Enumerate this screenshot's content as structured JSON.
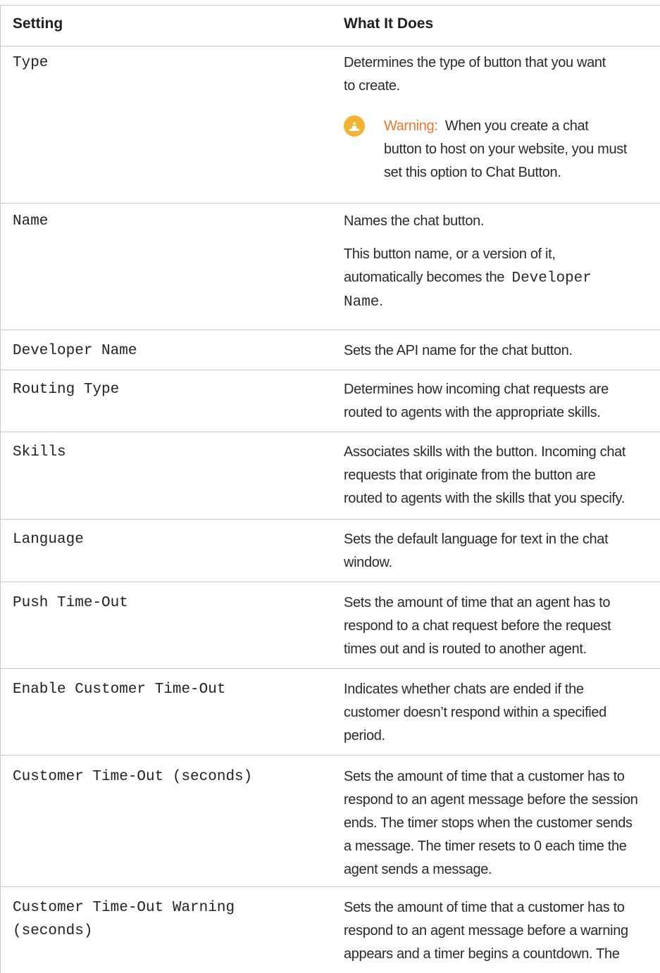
{
  "table": {
    "headers": {
      "setting": "Setting",
      "what_it_does": "What It Does"
    },
    "rows": [
      {
        "setting": "Type",
        "desc_lines": [
          "Determines the type of button that you want",
          "to create."
        ],
        "warning": {
          "label": "Warning:",
          "lines": [
            "When you create a chat",
            "button to host on your website, you must",
            "set this option to Chat Button."
          ]
        }
      },
      {
        "setting": "Name",
        "desc_lines": [
          "Names the chat button."
        ],
        "desc2_lines": [
          "This button name, or a version of it,",
          "automatically becomes the"
        ],
        "desc2_code_1": "Developer",
        "desc2_code_2": "Name",
        "desc2_end": "."
      },
      {
        "setting": "Developer Name",
        "desc_lines": [
          "Sets the API name for the chat button."
        ]
      },
      {
        "setting": "Routing Type",
        "desc_lines": [
          "Determines how incoming chat requests are",
          "routed to agents with the appropriate skills."
        ]
      },
      {
        "setting": "Skills",
        "desc_lines": [
          "Associates skills with the button. Incoming chat",
          "requests that originate from the button are",
          "routed to agents with the skills that you specify."
        ]
      },
      {
        "setting": "Language",
        "desc_lines": [
          "Sets the default language for text in the chat",
          "window."
        ]
      },
      {
        "setting": "Push Time-Out",
        "desc_lines": [
          "Sets the amount of time that an agent has to",
          "respond to a chat request before the request",
          "times out and is routed to another agent."
        ]
      },
      {
        "setting": "Enable Customer Time-Out",
        "desc_lines": [
          "Indicates whether chats are ended if the",
          "customer doesn’t respond within a specified",
          "period."
        ]
      },
      {
        "setting": "Customer Time-Out (seconds)",
        "desc_lines": [
          "Sets the amount of time that a customer has to",
          "respond to an agent message before the session",
          "ends. The timer stops when the customer sends",
          "a message. The timer resets to 0 each time the",
          "agent sends a message."
        ]
      },
      {
        "setting_lines": [
          "Customer Time-Out Warning",
          "(seconds)"
        ],
        "desc_lines": [
          "Sets the amount of time that a customer has to",
          "respond to an agent message before a warning",
          "appears and a timer begins a countdown. The"
        ]
      }
    ]
  },
  "icons": {
    "warning": "warning-cone-icon"
  },
  "colors": {
    "warning_label": "#e8792c",
    "warning_icon": "#f0b334",
    "rule": "#c9c9c9"
  }
}
